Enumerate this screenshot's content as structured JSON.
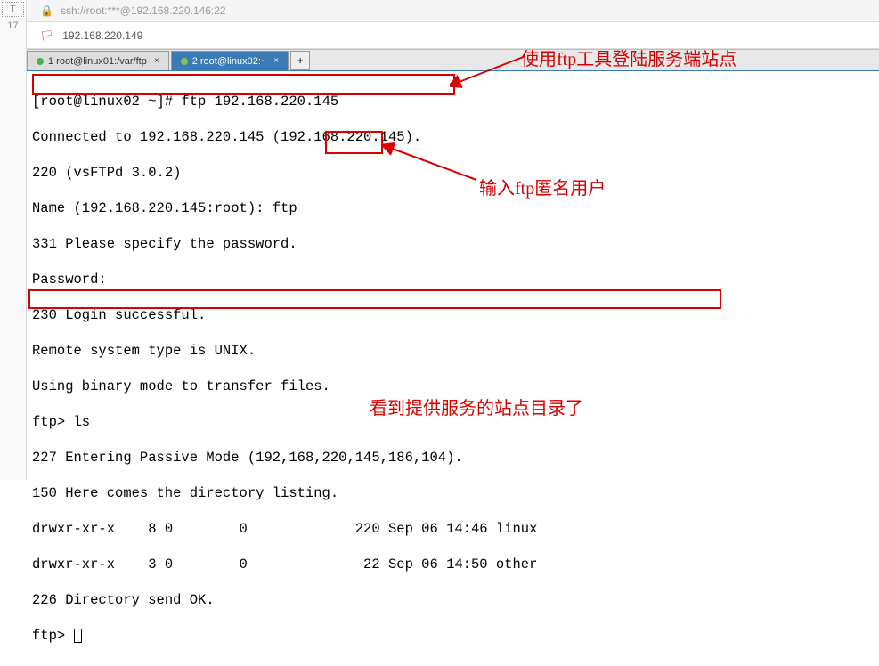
{
  "topbar": {
    "ssh_text": "ssh://root:***@192.168.220.146:22"
  },
  "addressbar": {
    "ip": "192.168.220.149"
  },
  "gutter": {
    "num": "17"
  },
  "tabs": {
    "tab1_label": "1 root@linux01:/var/ftp",
    "tab2_label": "2 root@linux02:~",
    "add_label": "+"
  },
  "terminal": {
    "l1_prompt": "[root@linux02 ~]# ",
    "l1_cmd": "ftp 192.168.220.145",
    "l2": "Connected to 192.168.220.145 (192.168.220.145).",
    "l3": "220 (vsFTPd 3.0.2)",
    "l4_prefix": "Name (192.168.220.145:root): ",
    "l4_input": "ftp",
    "l5": "331 Please specify the password.",
    "l6": "Password:",
    "l7": "230 Login successful.",
    "l8": "Remote system type is UNIX.",
    "l9": "Using binary mode to transfer files.",
    "l10": "ftp> ls",
    "l11": "227 Entering Passive Mode (192,168,220,145,186,104).",
    "l12": "150 Here comes the directory listing.",
    "l13": "drwxr-xr-x    8 0        0             220 Sep 06 14:46 linux",
    "l14": "drwxr-xr-x    3 0        0              22 Sep 06 14:50 other",
    "l15": "226 Directory send OK.",
    "l16": "ftp> "
  },
  "annotations": {
    "a1": "使用ftp工具登陆服务端站点",
    "a2": "输入ftp匿名用户",
    "a3": "看到提供服务的站点目录了"
  }
}
